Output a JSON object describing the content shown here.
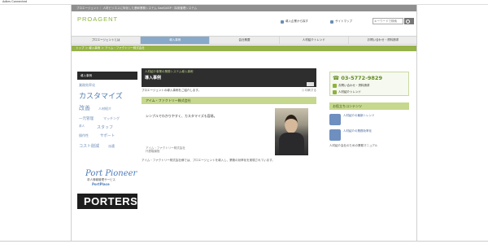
{
  "browser": {
    "tab_title": "Adbrs Connected",
    "status": ""
  },
  "topbar": {
    "text": "プロエージェント｜ 人材ビジネスに特化した基幹業務システム SaaS/ASP・採用管理システム"
  },
  "logo": {
    "text": "PROAGENT"
  },
  "utility": {
    "links": [
      "導入企業から探す",
      "サイトマップ"
    ],
    "search_placeholder": "キーワードで検索"
  },
  "nav": {
    "items": [
      {
        "label": "プロエージェントとは"
      },
      {
        "label": "導入事例"
      },
      {
        "label": "会社概要"
      },
      {
        "label": "人材紹介トレンド"
      },
      {
        "label": "お問い合わせ・資料請求"
      }
    ],
    "active_index": 1
  },
  "breadcrumb": {
    "text": "トップ ＞ 導入事例 ＞ アイム・ファクトリー株式会社"
  },
  "sidebar_left": {
    "heading": "導入事例",
    "tag_cloud": [
      "業務効率化",
      "カスタマイズ",
      "改善",
      "人材紹介",
      "一元管理",
      "マッチング",
      "求人",
      "スタッフ",
      "操作性",
      "サポート",
      "コスト削減",
      "派遣"
    ],
    "banner_port": {
      "logo": "Port Pioneer",
      "caption": "求人情報管理サービス",
      "brand": "PortPlace"
    },
    "banner_porters": {
      "text": "PORTERS"
    }
  },
  "main": {
    "case_subtitle": "人材紹介事業の業務システム導入事例",
    "case_title": "導入事例",
    "intro": "プロエージェントの導入事例をご紹介します。",
    "print_label": "印刷する",
    "company_heading": "アイム・ファクトリー株式会社",
    "lead_quote": "シンプルでわかりやすく、カスタマイズも容易。",
    "profile_text": [
      "アイム・ファクトリー株式会社",
      "代表取締役"
    ],
    "body": "アイム・ファクトリー株式会社様では、プロエージェントを導入し、業務の効率化を実現されています。"
  },
  "sidebar_right": {
    "phone": "03-5772-9829",
    "links": [
      "お問い合わせ・資料請求",
      "人材紹介トレンド"
    ],
    "content_heading": "お役立ちコンテンツ",
    "items": [
      "人材紹介の最新トレンド",
      "人材紹介の業務効率化"
    ],
    "item_footer": "人材紹介会社のための業務マニュアル"
  }
}
